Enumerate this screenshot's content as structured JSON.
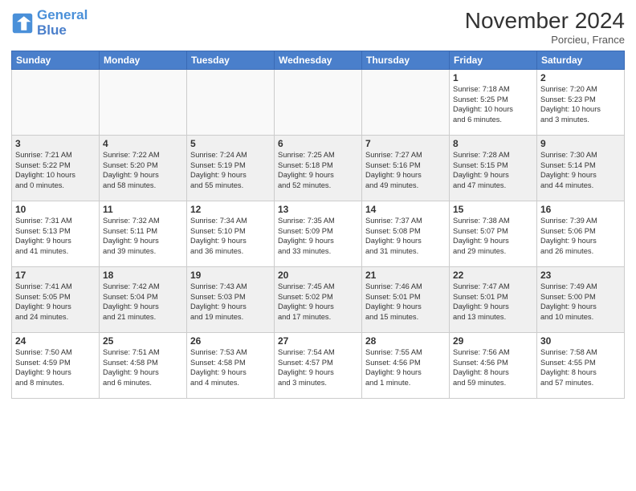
{
  "header": {
    "logo_line1": "General",
    "logo_line2": "Blue",
    "month": "November 2024",
    "location": "Porcieu, France"
  },
  "weekdays": [
    "Sunday",
    "Monday",
    "Tuesday",
    "Wednesday",
    "Thursday",
    "Friday",
    "Saturday"
  ],
  "weeks": [
    [
      {
        "day": "",
        "info": ""
      },
      {
        "day": "",
        "info": ""
      },
      {
        "day": "",
        "info": ""
      },
      {
        "day": "",
        "info": ""
      },
      {
        "day": "",
        "info": ""
      },
      {
        "day": "1",
        "info": "Sunrise: 7:18 AM\nSunset: 5:25 PM\nDaylight: 10 hours\nand 6 minutes."
      },
      {
        "day": "2",
        "info": "Sunrise: 7:20 AM\nSunset: 5:23 PM\nDaylight: 10 hours\nand 3 minutes."
      }
    ],
    [
      {
        "day": "3",
        "info": "Sunrise: 7:21 AM\nSunset: 5:22 PM\nDaylight: 10 hours\nand 0 minutes."
      },
      {
        "day": "4",
        "info": "Sunrise: 7:22 AM\nSunset: 5:20 PM\nDaylight: 9 hours\nand 58 minutes."
      },
      {
        "day": "5",
        "info": "Sunrise: 7:24 AM\nSunset: 5:19 PM\nDaylight: 9 hours\nand 55 minutes."
      },
      {
        "day": "6",
        "info": "Sunrise: 7:25 AM\nSunset: 5:18 PM\nDaylight: 9 hours\nand 52 minutes."
      },
      {
        "day": "7",
        "info": "Sunrise: 7:27 AM\nSunset: 5:16 PM\nDaylight: 9 hours\nand 49 minutes."
      },
      {
        "day": "8",
        "info": "Sunrise: 7:28 AM\nSunset: 5:15 PM\nDaylight: 9 hours\nand 47 minutes."
      },
      {
        "day": "9",
        "info": "Sunrise: 7:30 AM\nSunset: 5:14 PM\nDaylight: 9 hours\nand 44 minutes."
      }
    ],
    [
      {
        "day": "10",
        "info": "Sunrise: 7:31 AM\nSunset: 5:13 PM\nDaylight: 9 hours\nand 41 minutes."
      },
      {
        "day": "11",
        "info": "Sunrise: 7:32 AM\nSunset: 5:11 PM\nDaylight: 9 hours\nand 39 minutes."
      },
      {
        "day": "12",
        "info": "Sunrise: 7:34 AM\nSunset: 5:10 PM\nDaylight: 9 hours\nand 36 minutes."
      },
      {
        "day": "13",
        "info": "Sunrise: 7:35 AM\nSunset: 5:09 PM\nDaylight: 9 hours\nand 33 minutes."
      },
      {
        "day": "14",
        "info": "Sunrise: 7:37 AM\nSunset: 5:08 PM\nDaylight: 9 hours\nand 31 minutes."
      },
      {
        "day": "15",
        "info": "Sunrise: 7:38 AM\nSunset: 5:07 PM\nDaylight: 9 hours\nand 29 minutes."
      },
      {
        "day": "16",
        "info": "Sunrise: 7:39 AM\nSunset: 5:06 PM\nDaylight: 9 hours\nand 26 minutes."
      }
    ],
    [
      {
        "day": "17",
        "info": "Sunrise: 7:41 AM\nSunset: 5:05 PM\nDaylight: 9 hours\nand 24 minutes."
      },
      {
        "day": "18",
        "info": "Sunrise: 7:42 AM\nSunset: 5:04 PM\nDaylight: 9 hours\nand 21 minutes."
      },
      {
        "day": "19",
        "info": "Sunrise: 7:43 AM\nSunset: 5:03 PM\nDaylight: 9 hours\nand 19 minutes."
      },
      {
        "day": "20",
        "info": "Sunrise: 7:45 AM\nSunset: 5:02 PM\nDaylight: 9 hours\nand 17 minutes."
      },
      {
        "day": "21",
        "info": "Sunrise: 7:46 AM\nSunset: 5:01 PM\nDaylight: 9 hours\nand 15 minutes."
      },
      {
        "day": "22",
        "info": "Sunrise: 7:47 AM\nSunset: 5:01 PM\nDaylight: 9 hours\nand 13 minutes."
      },
      {
        "day": "23",
        "info": "Sunrise: 7:49 AM\nSunset: 5:00 PM\nDaylight: 9 hours\nand 10 minutes."
      }
    ],
    [
      {
        "day": "24",
        "info": "Sunrise: 7:50 AM\nSunset: 4:59 PM\nDaylight: 9 hours\nand 8 minutes."
      },
      {
        "day": "25",
        "info": "Sunrise: 7:51 AM\nSunset: 4:58 PM\nDaylight: 9 hours\nand 6 minutes."
      },
      {
        "day": "26",
        "info": "Sunrise: 7:53 AM\nSunset: 4:58 PM\nDaylight: 9 hours\nand 4 minutes."
      },
      {
        "day": "27",
        "info": "Sunrise: 7:54 AM\nSunset: 4:57 PM\nDaylight: 9 hours\nand 3 minutes."
      },
      {
        "day": "28",
        "info": "Sunrise: 7:55 AM\nSunset: 4:56 PM\nDaylight: 9 hours\nand 1 minute."
      },
      {
        "day": "29",
        "info": "Sunrise: 7:56 AM\nSunset: 4:56 PM\nDaylight: 8 hours\nand 59 minutes."
      },
      {
        "day": "30",
        "info": "Sunrise: 7:58 AM\nSunset: 4:55 PM\nDaylight: 8 hours\nand 57 minutes."
      }
    ]
  ]
}
